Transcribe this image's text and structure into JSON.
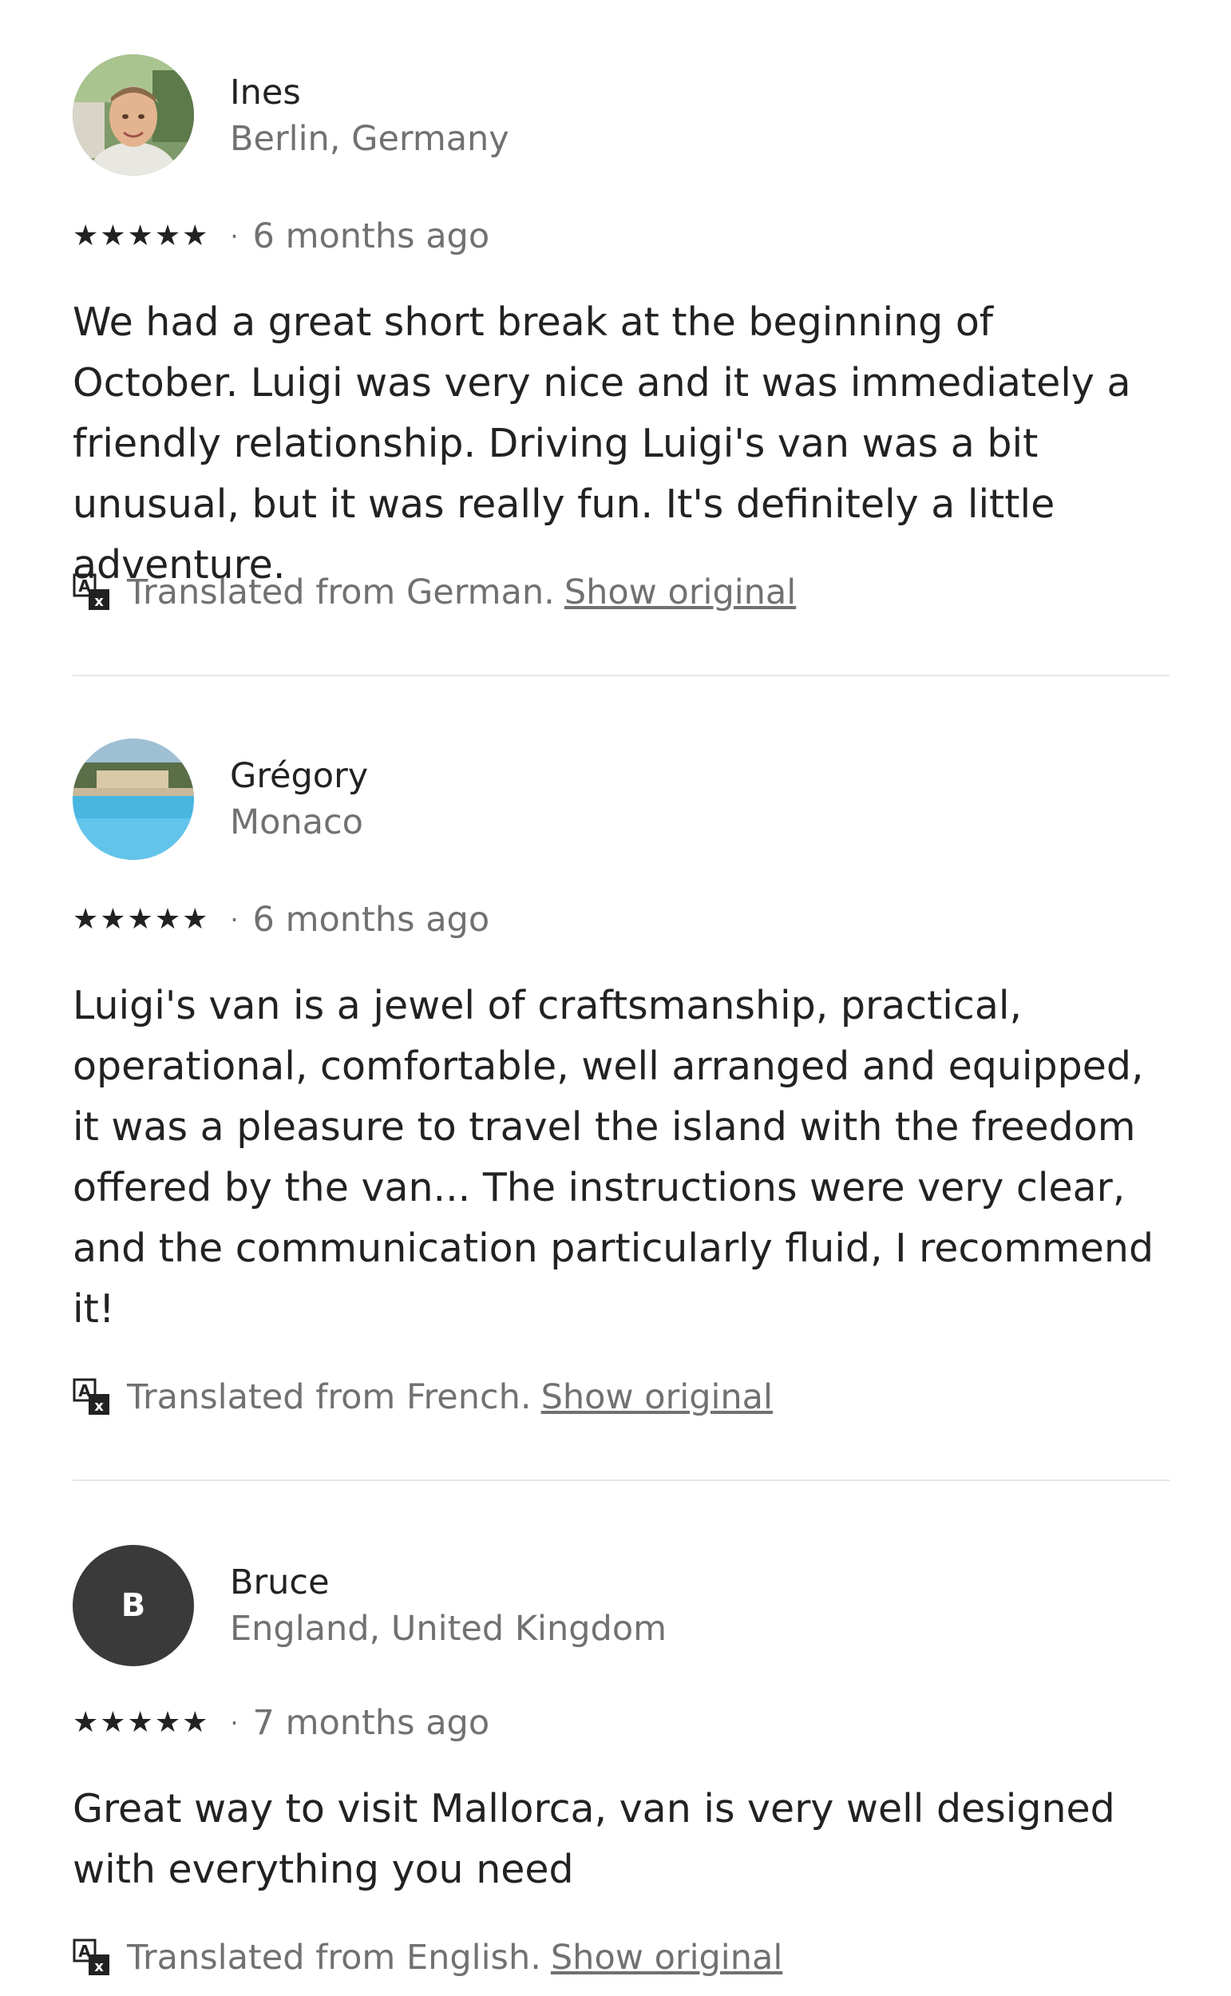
{
  "reviews": [
    {
      "name": "Ines",
      "location": "Berlin, Germany",
      "stars": "★★★★★",
      "separator": "·",
      "date": "6 months ago",
      "text": "We had a great short break at the beginning of October. Luigi was very nice and it was immediately a friendly relationship.  Driving Luigi's van was a bit unusual, but it was really fun. It's definitely a little adventure.",
      "translated": "Translated from German.",
      "show_original": "Show original",
      "avatar": "photo"
    },
    {
      "name": "Grégory",
      "location": "Monaco",
      "stars": "★★★★★",
      "separator": "·",
      "date": "6 months ago",
      "text": "Luigi's van is a jewel of craftsmanship, practical, operational, comfortable, well arranged and equipped, it was a pleasure to travel the island with the freedom offered by the van... The instructions were very clear, and the communication particularly fluid, I recommend it!",
      "translated": "Translated from French.",
      "show_original": "Show original",
      "avatar": "photo"
    },
    {
      "name": "Bruce",
      "location": "England, United Kingdom",
      "stars": "★★★★★",
      "separator": "·",
      "date": "7 months ago",
      "text": "Great way to visit Mallorca, van is very well designed with everything you need",
      "translated": "Translated from English.",
      "show_original": "Show original",
      "avatar": "letter",
      "avatar_letter": "B"
    }
  ],
  "colors": {
    "text": "#222222",
    "secondary": "#717171",
    "divider": "#e6e6e6",
    "avatar_bg": "#3a3a3a"
  },
  "icons": {
    "translate": "translate-icon",
    "star": "star-icon"
  }
}
